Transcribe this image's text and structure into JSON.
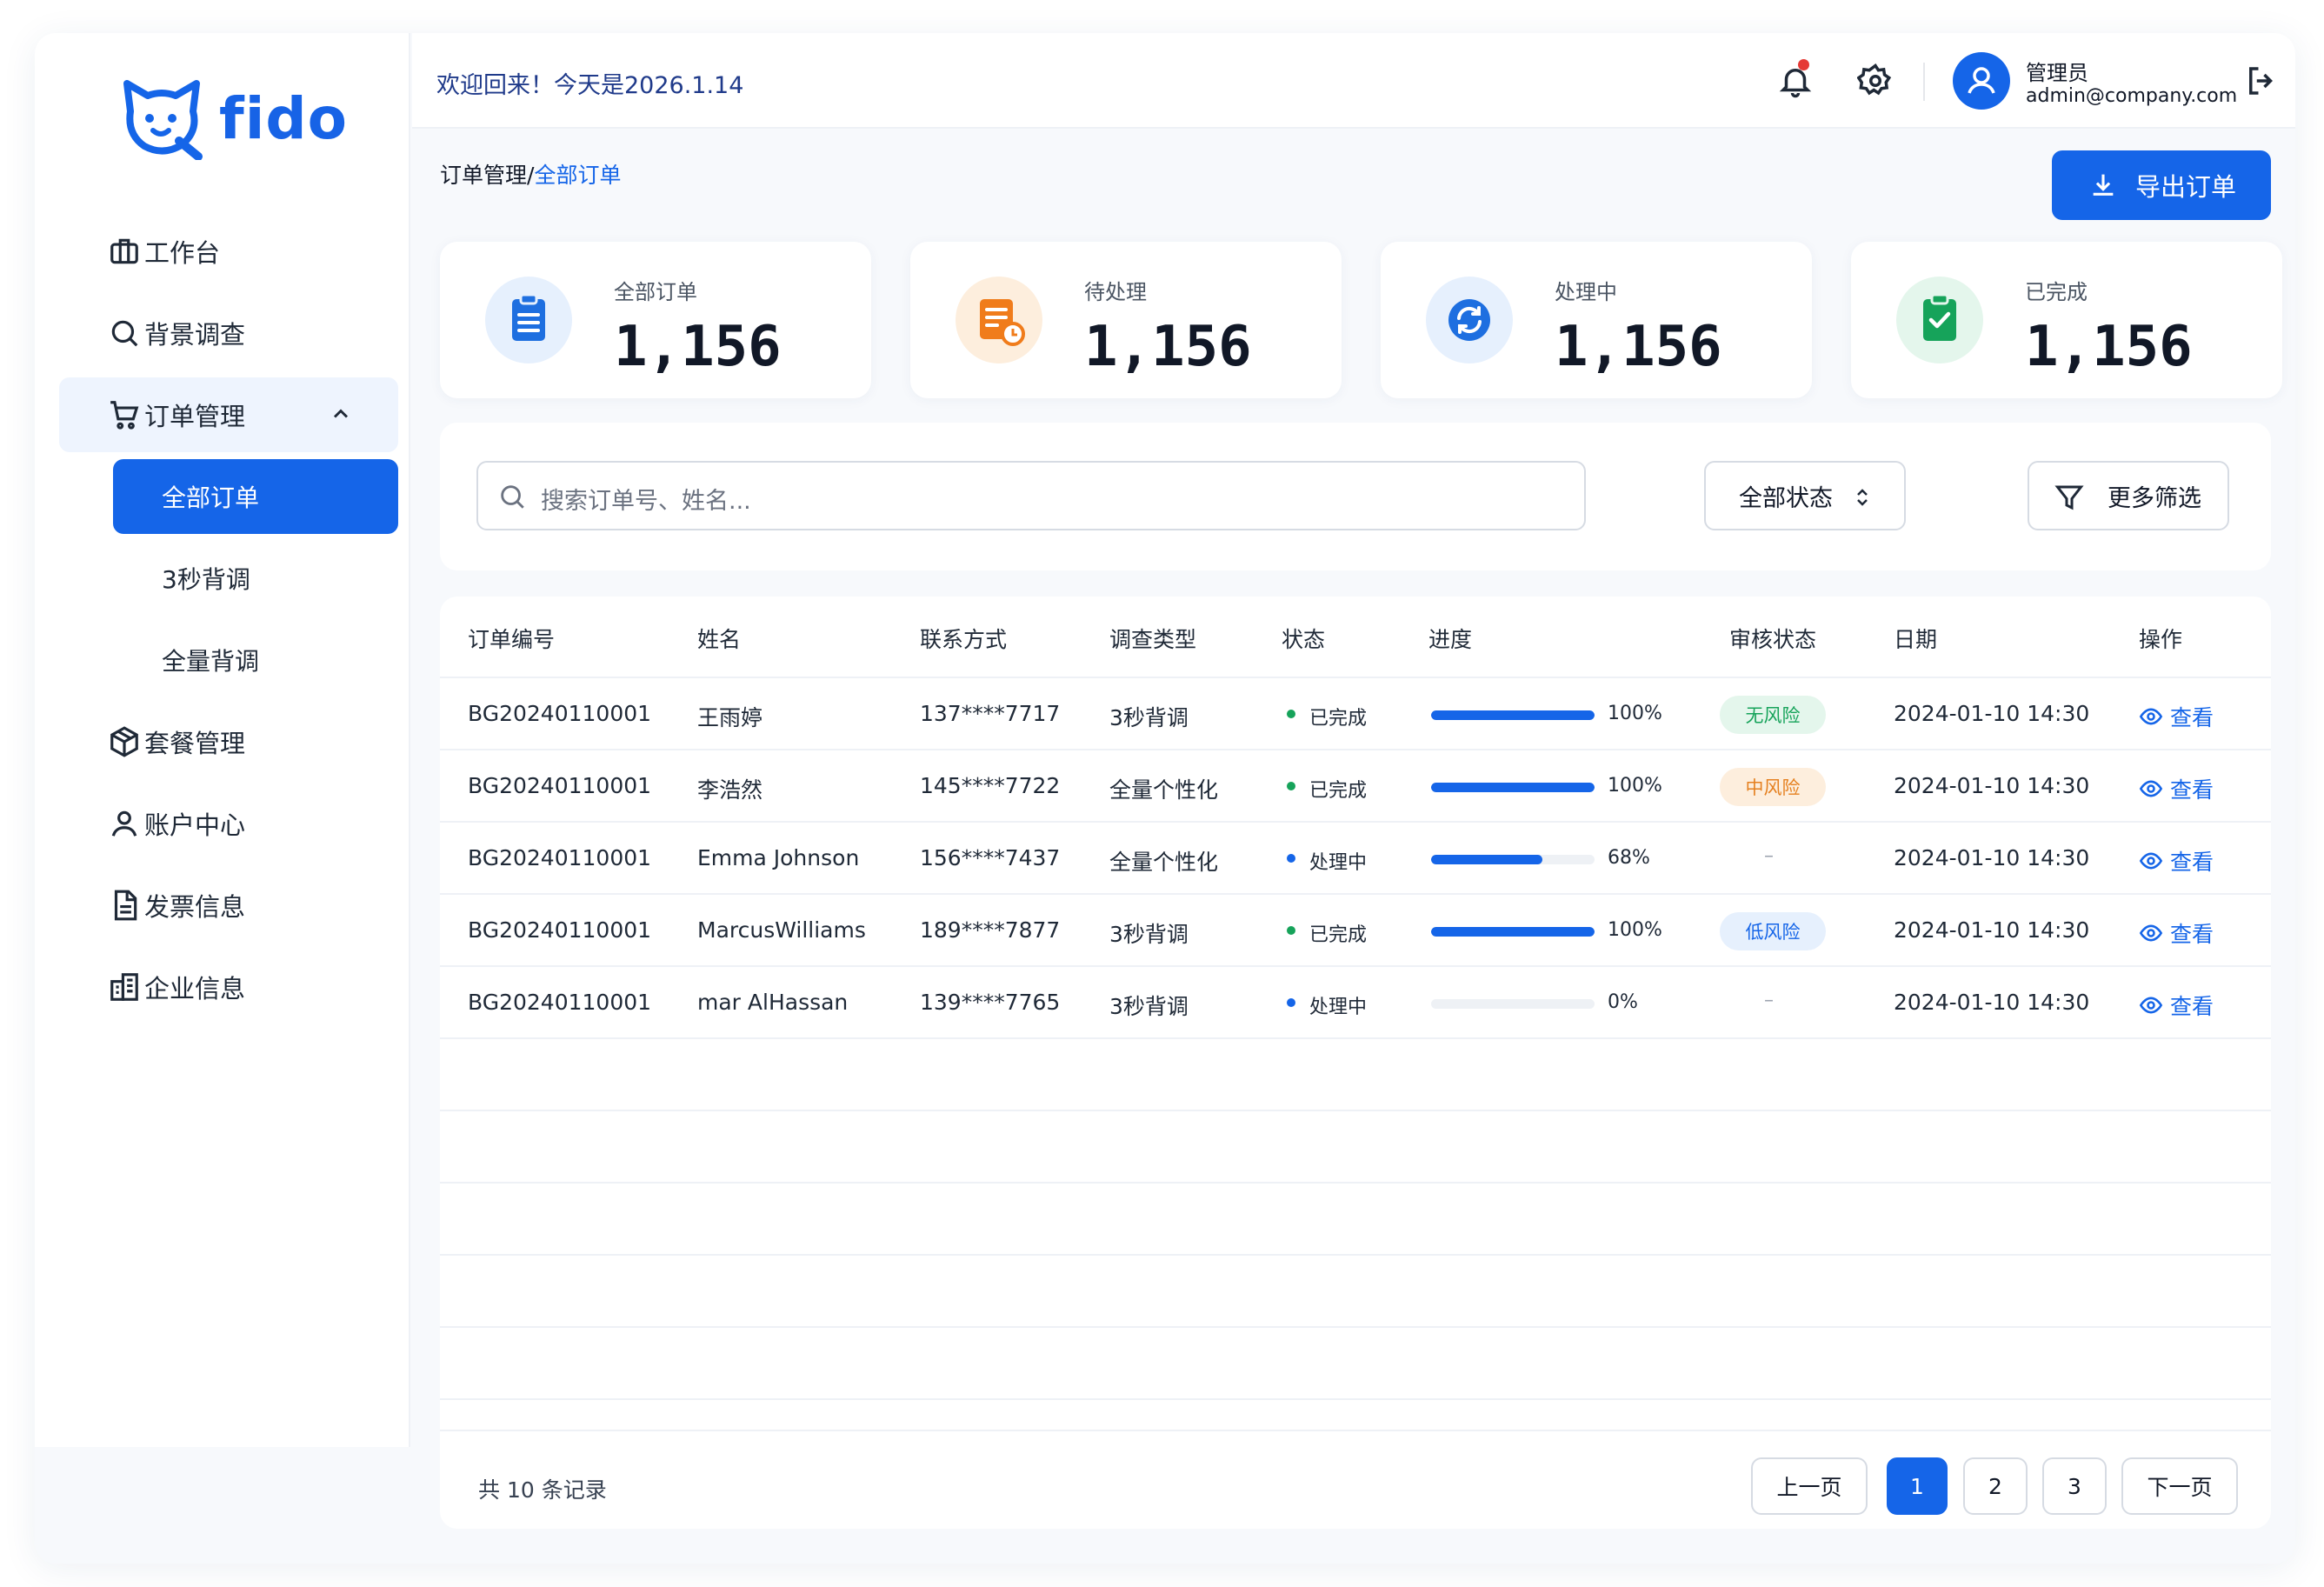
{
  "brand": {
    "name": "fido",
    "color": "#1565e8"
  },
  "header": {
    "welcome": "欢迎回来！今天是2026.1.14",
    "user_name": "管理员",
    "user_email": "admin@company.com",
    "icons": [
      "bell-icon",
      "gear-icon",
      "user-icon",
      "logout-icon"
    ]
  },
  "sidebar": {
    "items": [
      {
        "label": "工作台",
        "icon": "briefcase-icon"
      },
      {
        "label": "背景调查",
        "icon": "search-icon"
      },
      {
        "label": "订单管理",
        "icon": "cart-icon",
        "expanded": true
      },
      {
        "label": "套餐管理",
        "icon": "box-icon"
      },
      {
        "label": "账户中心",
        "icon": "user-icon"
      },
      {
        "label": "发票信息",
        "icon": "document-icon"
      },
      {
        "label": "企业信息",
        "icon": "building-icon"
      }
    ],
    "sub_items": [
      {
        "label": "全部订单",
        "active": true
      },
      {
        "label": "3秒背调"
      },
      {
        "label": "全量背调"
      }
    ]
  },
  "breadcrumb": {
    "parent": "订单管理",
    "sep": "/",
    "current": "全部订单"
  },
  "export_label": "导出订单",
  "stats": [
    {
      "label": "全部订单",
      "value": "1,156",
      "icon": "clipboard-icon",
      "color": "#1e6fe0",
      "bg": "#e6f0fd"
    },
    {
      "label": "待处理",
      "value": "1,156",
      "icon": "pending-doc-icon",
      "color": "#f07c1b",
      "bg": "#fdeedd"
    },
    {
      "label": "处理中",
      "value": "1,156",
      "icon": "sync-icon",
      "color": "#1e6fe0",
      "bg": "#e6f0fd"
    },
    {
      "label": "已完成",
      "value": "1,156",
      "icon": "check-clipboard-icon",
      "color": "#16a35a",
      "bg": "#e4f6ec"
    }
  ],
  "filters": {
    "search_placeholder": "搜索订单号、姓名...",
    "status_select": "全部状态",
    "more_filters": "更多筛选"
  },
  "table": {
    "columns": [
      "订单编号",
      "姓名",
      "联系方式",
      "调查类型",
      "状态",
      "进度",
      "审核状态",
      "日期",
      "操作"
    ],
    "rows": [
      {
        "id": "BG20240110001",
        "name": "王雨婷",
        "phone": "137****7717",
        "type": "3秒背调",
        "status": "已完成",
        "status_color": "#16a35a",
        "progress": 100,
        "progress_label": "100%",
        "review": "无风险",
        "review_fg": "#16a35a",
        "review_bg": "#e4f6ec",
        "date": "2024-01-10 14:30",
        "action": "查看"
      },
      {
        "id": "BG20240110001",
        "name": "李浩然",
        "phone": "145****7722",
        "type": "全量个性化",
        "status": "已完成",
        "status_color": "#16a35a",
        "progress": 100,
        "progress_label": "100%",
        "review": "中风险",
        "review_fg": "#e5801f",
        "review_bg": "#fdeedd",
        "date": "2024-01-10 14:30",
        "action": "查看"
      },
      {
        "id": "BG20240110001",
        "name": "Emma Johnson",
        "phone": "156****7437",
        "type": "全量个性化",
        "status": "处理中",
        "status_color": "#1565e8",
        "progress": 68,
        "progress_label": "68%",
        "review": "–",
        "date": "2024-01-10 14:30",
        "action": "查看"
      },
      {
        "id": "BG20240110001",
        "name": "MarcusWilliams",
        "phone": "189****7877",
        "type": "3秒背调",
        "status": "已完成",
        "status_color": "#16a35a",
        "progress": 100,
        "progress_label": "100%",
        "review": "低风险",
        "review_fg": "#1565e8",
        "review_bg": "#e6f0fd",
        "date": "2024-01-10 14:30",
        "action": "查看"
      },
      {
        "id": "BG20240110001",
        "name": "mar AlHassan",
        "phone": "139****7765",
        "type": "3秒背调",
        "status": "处理中",
        "status_color": "#1565e8",
        "progress": 0,
        "progress_label": "0%",
        "review": "–",
        "date": "2024-01-10 14:30",
        "action": "查看"
      }
    ]
  },
  "pagination": {
    "total": "共 10 条记录",
    "prev": "上一页",
    "pages": [
      "1",
      "2",
      "3"
    ],
    "current": "1",
    "next": "下一页"
  }
}
